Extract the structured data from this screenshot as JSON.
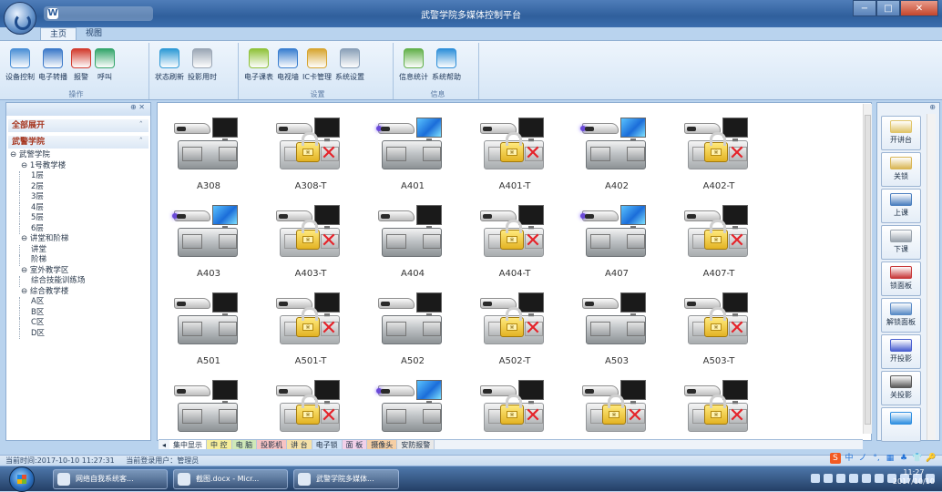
{
  "window": {
    "title": "武警学院多媒体控制平台",
    "min": "−",
    "max": "□",
    "close": "✕",
    "qat_icon": "W"
  },
  "tabs": [
    "主页",
    "视图"
  ],
  "ribbon": {
    "groups": [
      {
        "label": "操作",
        "buttons": [
          {
            "label": "设备控制",
            "icon": "device-control-icon",
            "color": "#4a8fd6"
          },
          {
            "label": "电子转播",
            "icon": "relay-icon",
            "color": "#3b79c9"
          },
          {
            "label": "报警",
            "icon": "alarm-icon",
            "color": "#d23b2e"
          },
          {
            "label": "呼叫",
            "icon": "call-icon",
            "color": "#34a56b"
          }
        ]
      },
      {
        "label": "",
        "buttons": [
          {
            "label": "状态刷新",
            "icon": "refresh-icon",
            "color": "#2f9ad6"
          },
          {
            "label": "投影用时",
            "icon": "clock-icon",
            "color": "#9aa6b5"
          }
        ]
      },
      {
        "label": "设置",
        "buttons": [
          {
            "label": "电子课表",
            "icon": "schedule-icon",
            "color": "#8fc23a"
          },
          {
            "label": "电视墙",
            "icon": "tv-wall-icon",
            "color": "#3a7fd0"
          },
          {
            "label": "IC卡管理",
            "icon": "ic-card-icon",
            "color": "#d7a531"
          },
          {
            "label": "系统设置",
            "icon": "settings-icon",
            "color": "#8aa0b8"
          }
        ]
      },
      {
        "label": "信息",
        "buttons": [
          {
            "label": "信息统计",
            "icon": "statistics-icon",
            "color": "#62b04a"
          },
          {
            "label": "系统帮助",
            "icon": "help-icon",
            "color": "#2e8fd9"
          }
        ]
      }
    ]
  },
  "left": {
    "pin": "⊕ ✕",
    "expand_all": "全部展开",
    "section": "武警学院",
    "chevron": "ˆ",
    "tree": [
      {
        "text": "⊖ 武警学院",
        "indent": 0
      },
      {
        "text": "⊖ 1号教学楼",
        "indent": 1
      },
      {
        "text": "1层",
        "indent": 2
      },
      {
        "text": "2层",
        "indent": 2
      },
      {
        "text": "3层",
        "indent": 2
      },
      {
        "text": "4层",
        "indent": 2
      },
      {
        "text": "5层",
        "indent": 2
      },
      {
        "text": "6层",
        "indent": 2
      },
      {
        "text": "⊖ 讲堂和阶梯",
        "indent": 1
      },
      {
        "text": "讲堂",
        "indent": 2
      },
      {
        "text": "阶梯",
        "indent": 2
      },
      {
        "text": "⊖ 室外教学区",
        "indent": 1
      },
      {
        "text": "综合技能训练场",
        "indent": 2
      },
      {
        "text": "⊖ 综合教学楼",
        "indent": 1
      },
      {
        "text": "A区",
        "indent": 2
      },
      {
        "text": "B区",
        "indent": 2
      },
      {
        "text": "C区",
        "indent": 2
      },
      {
        "text": "D区",
        "indent": 2
      }
    ]
  },
  "rooms": [
    {
      "name": "A308",
      "locked": false,
      "projector_on": false,
      "monitor_on": false
    },
    {
      "name": "A308-T",
      "locked": true,
      "projector_on": false,
      "monitor_on": false
    },
    {
      "name": "A401",
      "locked": false,
      "projector_on": true,
      "monitor_on": true
    },
    {
      "name": "A401-T",
      "locked": true,
      "projector_on": false,
      "monitor_on": false
    },
    {
      "name": "A402",
      "locked": false,
      "projector_on": true,
      "monitor_on": true
    },
    {
      "name": "A402-T",
      "locked": true,
      "projector_on": false,
      "monitor_on": false
    },
    {
      "name": "A403",
      "locked": false,
      "projector_on": true,
      "monitor_on": true
    },
    {
      "name": "A403-T",
      "locked": true,
      "projector_on": false,
      "monitor_on": false
    },
    {
      "name": "A404",
      "locked": false,
      "projector_on": false,
      "monitor_on": false
    },
    {
      "name": "A404-T",
      "locked": true,
      "projector_on": false,
      "monitor_on": false
    },
    {
      "name": "A407",
      "locked": false,
      "projector_on": true,
      "monitor_on": true
    },
    {
      "name": "A407-T",
      "locked": true,
      "projector_on": false,
      "monitor_on": false
    },
    {
      "name": "A501",
      "locked": false,
      "projector_on": false,
      "monitor_on": false
    },
    {
      "name": "A501-T",
      "locked": true,
      "projector_on": false,
      "monitor_on": false
    },
    {
      "name": "A502",
      "locked": false,
      "projector_on": false,
      "monitor_on": false
    },
    {
      "name": "A502-T",
      "locked": true,
      "projector_on": false,
      "monitor_on": false
    },
    {
      "name": "A503",
      "locked": false,
      "projector_on": false,
      "monitor_on": false
    },
    {
      "name": "A503-T",
      "locked": true,
      "projector_on": false,
      "monitor_on": false
    },
    {
      "name": "",
      "locked": false,
      "projector_on": false,
      "monitor_on": false
    },
    {
      "name": "",
      "locked": true,
      "projector_on": false,
      "monitor_on": false
    },
    {
      "name": "",
      "locked": false,
      "projector_on": true,
      "monitor_on": true
    },
    {
      "name": "",
      "locked": true,
      "projector_on": false,
      "monitor_on": false
    },
    {
      "name": "",
      "locked": true,
      "projector_on": false,
      "monitor_on": false
    },
    {
      "name": "",
      "locked": true,
      "projector_on": false,
      "monitor_on": false
    }
  ],
  "bottom_tabs": [
    "集中显示",
    "中 控",
    "电 脑",
    "投影机",
    "讲 台",
    "电子锁",
    "面 板",
    "摄像头",
    "安防报警"
  ],
  "bottom_tab_colors": [
    "#ffffff",
    "#f6ee9a",
    "#cfe8b8",
    "#f7c3c3",
    "#f5e1a8",
    "#cfe2f7",
    "#f2d0e9",
    "#f6cfa4",
    "#e8e8e8"
  ],
  "right": {
    "pin": "⊕",
    "buttons": [
      {
        "label": "开讲台",
        "icon": "open-podium-icon",
        "color": "#e0c56a"
      },
      {
        "label": "关锁",
        "icon": "lock-icon",
        "color": "#d9b655"
      },
      {
        "label": "上课",
        "icon": "class-start-icon",
        "color": "#4b7fbf"
      },
      {
        "label": "下课",
        "icon": "class-end-icon",
        "color": "#9aa3ad"
      },
      {
        "label": "锁面板",
        "icon": "lock-panel-icon",
        "color": "#c8393a"
      },
      {
        "label": "解锁面板",
        "icon": "unlock-panel-icon",
        "color": "#5a8bc6"
      },
      {
        "label": "开投影",
        "icon": "projector-on-icon",
        "color": "#4a5fd0"
      },
      {
        "label": "关投影",
        "icon": "projector-off-icon",
        "color": "#5a5a5a"
      },
      {
        "label": "",
        "icon": "screen-icon",
        "color": "#2f8fe0"
      }
    ]
  },
  "status": {
    "time": "当前时间:2017-10-10 11:27:31",
    "user": "当前登录用户：管理员"
  },
  "ime": [
    "S",
    "中",
    "ノ",
    "°,",
    "▦",
    "♣",
    "👕",
    "🔑"
  ],
  "taskbar": {
    "items": [
      "网络自我系统客...",
      "截图.docx - Micr...",
      "武警学院多媒体..."
    ],
    "time": "11:27",
    "date": "2017/10/10"
  }
}
